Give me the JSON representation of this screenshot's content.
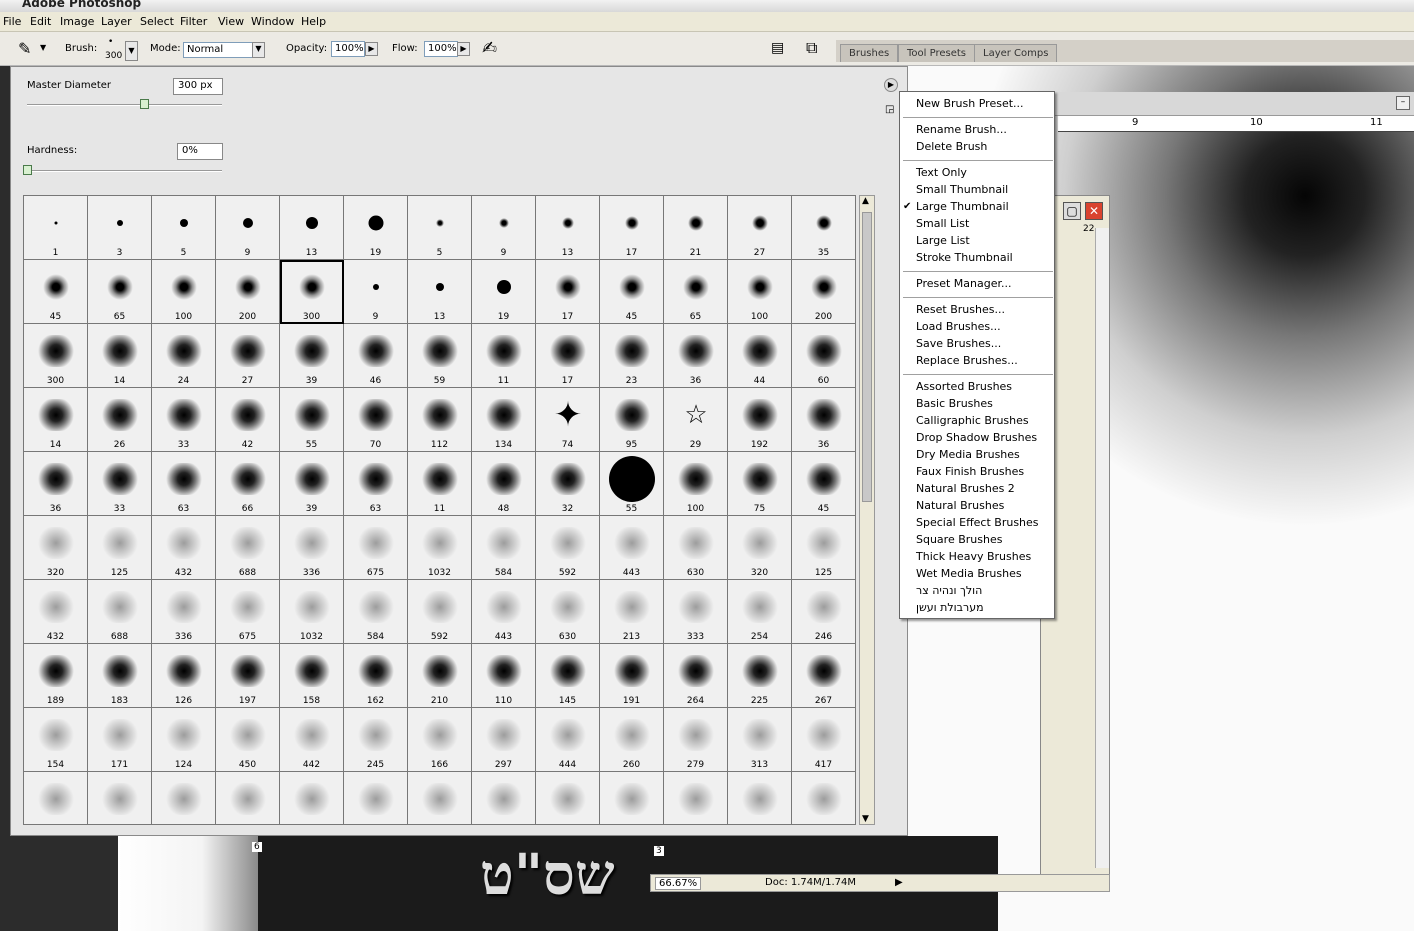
{
  "app": {
    "title": "Adobe Photoshop"
  },
  "menubar": [
    "File",
    "Edit",
    "Image",
    "Layer",
    "Select",
    "Filter",
    "View",
    "Window",
    "Help"
  ],
  "options": {
    "brush_label": "Brush:",
    "brush_size": "300",
    "mode_label": "Mode:",
    "mode_value": "Normal",
    "opacity_label": "Opacity:",
    "opacity_value": "100%",
    "flow_label": "Flow:",
    "flow_value": "100%"
  },
  "palette_tabs": [
    "Brushes",
    "Tool Presets",
    "Layer Comps"
  ],
  "brush_panel": {
    "master_diameter_label": "Master Diameter",
    "master_diameter_value": "300 px",
    "master_diameter_fraction": 0.6,
    "hardness_label": "Hardness:",
    "hardness_value": "0%",
    "hardness_fraction": 0.0,
    "selected_brush": "300",
    "brush_sizes": [
      [
        "1",
        "3",
        "5",
        "9",
        "13",
        "19",
        "5",
        "9",
        "13",
        "17",
        "21",
        "27",
        "35"
      ],
      [
        "45",
        "65",
        "100",
        "200",
        "300",
        "9",
        "13",
        "19",
        "17",
        "45",
        "65",
        "100",
        "200"
      ],
      [
        "300",
        "14",
        "24",
        "27",
        "39",
        "46",
        "59",
        "11",
        "17",
        "23",
        "36",
        "44",
        "60"
      ],
      [
        "14",
        "26",
        "33",
        "42",
        "55",
        "70",
        "112",
        "134",
        "74",
        "95",
        "29",
        "192",
        "36"
      ],
      [
        "36",
        "33",
        "63",
        "66",
        "39",
        "63",
        "11",
        "48",
        "32",
        "55",
        "100",
        "75",
        "45"
      ],
      [
        "320",
        "125",
        "432",
        "688",
        "336",
        "675",
        "1032",
        "584",
        "592",
        "443",
        "630",
        "320",
        "125"
      ],
      [
        "432",
        "688",
        "336",
        "675",
        "1032",
        "584",
        "592",
        "443",
        "630",
        "213",
        "333",
        "254",
        "246"
      ],
      [
        "189",
        "183",
        "126",
        "197",
        "158",
        "162",
        "210",
        "110",
        "145",
        "191",
        "264",
        "225",
        "267"
      ],
      [
        "154",
        "171",
        "124",
        "450",
        "442",
        "245",
        "166",
        "297",
        "444",
        "260",
        "279",
        "313",
        "417"
      ],
      [
        "",
        "",
        "",
        "",
        "",
        "",
        "",
        "",
        "",
        "",
        "",
        "",
        ""
      ]
    ]
  },
  "flyout_menu": {
    "groups": [
      [
        "New Brush Preset..."
      ],
      [
        "Rename Brush...",
        "Delete Brush"
      ],
      [
        "Text Only",
        "Small Thumbnail",
        "Large Thumbnail",
        "Small List",
        "Large List",
        "Stroke Thumbnail"
      ],
      [
        "Preset Manager..."
      ],
      [
        "Reset Brushes...",
        "Load Brushes...",
        "Save Brushes...",
        "Replace Brushes..."
      ],
      [
        "Assorted Brushes",
        "Basic Brushes",
        "Calligraphic Brushes",
        "Drop Shadow Brushes",
        "Dry Media Brushes",
        "Faux Finish Brushes",
        "Natural Brushes 2",
        "Natural Brushes",
        "Special Effect Brushes",
        "Square Brushes",
        "Thick Heavy Brushes",
        "Wet Media Brushes",
        "הולך ונהיה צר",
        "מערבולת ועשן"
      ]
    ],
    "checked_item": "Large Thumbnail"
  },
  "document": {
    "ruler_labels": [
      "9",
      "10",
      "11"
    ],
    "zoom": "66.67%",
    "doc_size": "Doc: 1.74M/1.74M",
    "canvas_text": "שס\"ט",
    "small_ruler_a": "6",
    "small_ruler_b": "3",
    "small_ruler_c": "22"
  }
}
